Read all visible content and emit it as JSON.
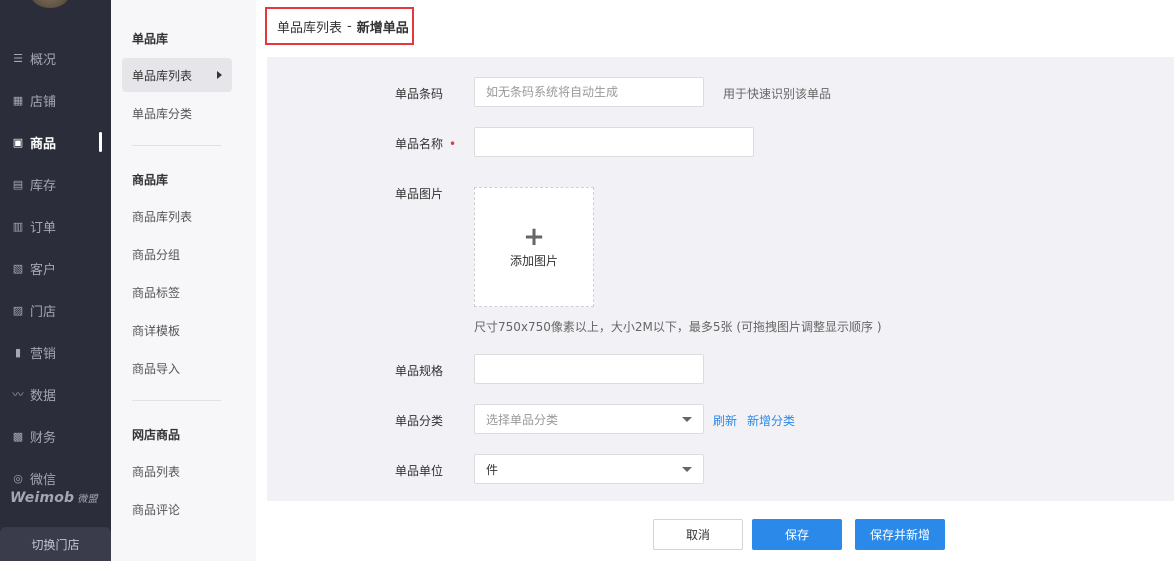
{
  "nav": {
    "items": [
      {
        "label": "概况",
        "icon": "list-icon"
      },
      {
        "label": "店铺",
        "icon": "store-icon"
      },
      {
        "label": "商品",
        "icon": "goods-icon"
      },
      {
        "label": "库存",
        "icon": "inventory-icon"
      },
      {
        "label": "订单",
        "icon": "order-icon"
      },
      {
        "label": "客户",
        "icon": "customer-icon"
      },
      {
        "label": "门店",
        "icon": "shop-icon"
      },
      {
        "label": "营销",
        "icon": "bar-chart-icon"
      },
      {
        "label": "数据",
        "icon": "line-chart-icon"
      },
      {
        "label": "财务",
        "icon": "calculator-icon"
      },
      {
        "label": "微信",
        "icon": "wechat-icon"
      }
    ],
    "active": "商品",
    "logo": "Weimob",
    "logo_sub": "微盟",
    "switch_store": "切换门店"
  },
  "submenu": {
    "groups": [
      {
        "title": "单品库",
        "items": [
          "单品库列表",
          "单品库分类"
        ]
      },
      {
        "title": "商品库",
        "items": [
          "商品库列表",
          "商品分组",
          "商品标签",
          "商详模板",
          "商品导入"
        ]
      },
      {
        "title": "网店商品",
        "items": [
          "商品列表",
          "商品评论"
        ]
      }
    ],
    "active": "单品库列表"
  },
  "breadcrumb": {
    "parent": "单品库列表",
    "separator": "-",
    "current": "新增单品"
  },
  "form": {
    "barcode": {
      "label": "单品条码",
      "placeholder": "如无条码系统将自动生成",
      "value": "",
      "hint": "用于快速识别该单品"
    },
    "name": {
      "label": "单品名称",
      "required_mark": "•",
      "value": ""
    },
    "image": {
      "label": "单品图片",
      "add_label": "添加图片",
      "hint": "尺寸750x750像素以上，大小2M以下，最多5张 (可拖拽图片调整显示顺序 )"
    },
    "spec": {
      "label": "单品规格",
      "value": ""
    },
    "category": {
      "label": "单品分类",
      "placeholder": "选择单品分类",
      "refresh": "刷新",
      "add_category": "新增分类"
    },
    "unit": {
      "label": "单品单位",
      "value": "件"
    }
  },
  "actions": {
    "cancel": "取消",
    "save": "保存",
    "save_and_add": "保存并新增"
  }
}
